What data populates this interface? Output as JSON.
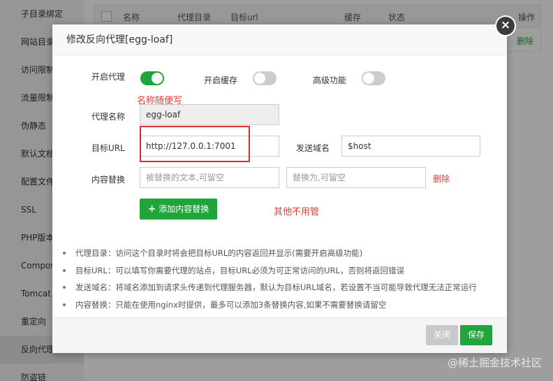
{
  "background": {
    "sidebar_items": [
      {
        "label": "子目录绑定"
      },
      {
        "label": "网站目录"
      },
      {
        "label": "访问限制"
      },
      {
        "label": "流量限制"
      },
      {
        "label": "伪静态"
      },
      {
        "label": "默认文档"
      },
      {
        "label": "配置文件"
      },
      {
        "label": "SSL"
      },
      {
        "label": "PHP版本"
      },
      {
        "label": "Composer"
      },
      {
        "label": "Tomcat"
      },
      {
        "label": "重定向"
      },
      {
        "label": "反向代理"
      },
      {
        "label": "防盗链"
      }
    ],
    "table_headers": {
      "name": "名称",
      "proxy_dir": "代理目录",
      "target_url": "目标url",
      "cache": "缓存",
      "status": "状态",
      "action": "操作"
    },
    "row_delete": "删除"
  },
  "modal": {
    "title": "修改反向代理[egg-loaf]",
    "close_glyph": "×",
    "toggles": {
      "enable_proxy": {
        "label": "开启代理",
        "on": true
      },
      "enable_cache": {
        "label": "开启缓存",
        "on": false
      },
      "advanced": {
        "label": "高级功能",
        "on": false
      }
    },
    "annotation_name": "名称随便写",
    "proxy_name": {
      "label": "代理名称",
      "value": "egg-loaf"
    },
    "target_url": {
      "label": "目标URL",
      "value": "http://127.0.0.1:7001"
    },
    "send_domain": {
      "label": "发送域名",
      "value": "$host"
    },
    "content_replace": {
      "label": "内容替换",
      "from_placeholder": "被替换的文本,可留空",
      "to_placeholder": "替换为,可留空",
      "delete_label": "删除"
    },
    "add_replace_button": {
      "icon": "plus-icon",
      "label": "添加内容替换"
    },
    "annotation_other": "其他不用管",
    "notes": [
      "代理目录：访问这个目录时将会把目标URL的内容返回并显示(需要开启高级功能)",
      "目标URL：可以填写你需要代理的站点，目标URL必须为可正常访问的URL，否则将返回错误",
      "发送域名：将域名添加到请求头传递到代理服务器，默认为目标URL域名，若设置不当可能导致代理无法正常运行",
      "内容替换：只能在使用nginx时提供，最多可以添加3条替换内容,如果不需要替换请留空"
    ],
    "footer": {
      "close_label": "关闭",
      "save_label": "保存"
    }
  },
  "watermark": "@稀土掘金技术社区",
  "colors": {
    "accent": "#20a53a",
    "danger": "#e53935",
    "toggle_off": "#cccccc"
  }
}
